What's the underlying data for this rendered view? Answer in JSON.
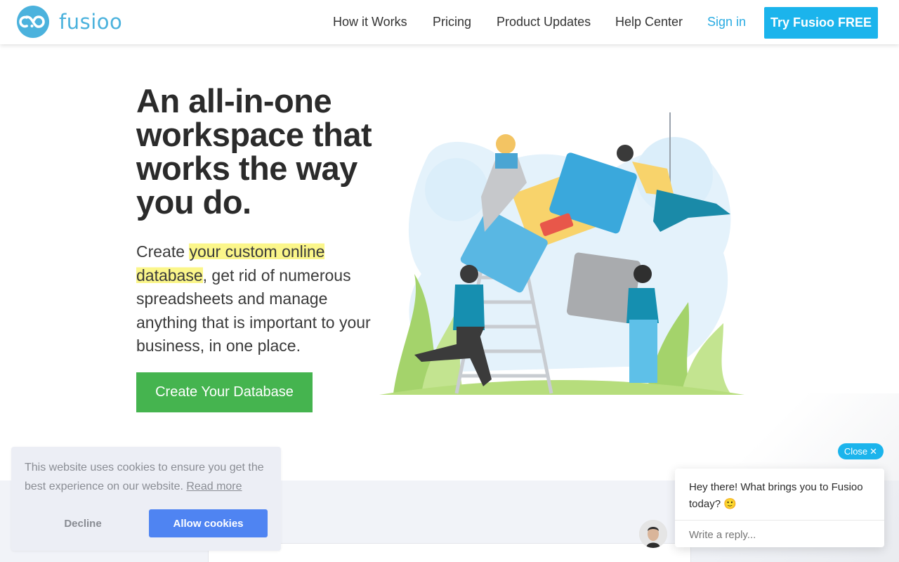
{
  "header": {
    "logo_text": "fusioo",
    "nav": [
      {
        "label": "How it Works"
      },
      {
        "label": "Pricing"
      },
      {
        "label": "Product Updates"
      },
      {
        "label": "Help Center"
      }
    ],
    "signin_label": "Sign in",
    "cta_label": "Try Fusioo FREE"
  },
  "hero": {
    "title": "An all-in-one workspace that works the way you do.",
    "subtitle_prefix": "Create ",
    "subtitle_highlight": "your custom online database",
    "subtitle_suffix": ", get rid of numerous spreadsheets and manage anything that is important to your business, in one place.",
    "cta_label": "Create Your Database"
  },
  "cookie_banner": {
    "text": "This website uses cookies to ensure you get the best experience on our website.",
    "read_more": "Read more",
    "decline_label": "Decline",
    "allow_label": "Allow cookies"
  },
  "chat": {
    "close_label": "Close",
    "close_icon": "✕",
    "message": "Hey there! What brings you to Fusioo today? 🙂",
    "input_placeholder": "Write a reply..."
  },
  "colors": {
    "brand": "#4bb2dd",
    "cta_blue": "#1bb4ec",
    "cta_green": "#45b44f",
    "highlight": "#fbf68a",
    "cookie_allow": "#4f84f2"
  }
}
